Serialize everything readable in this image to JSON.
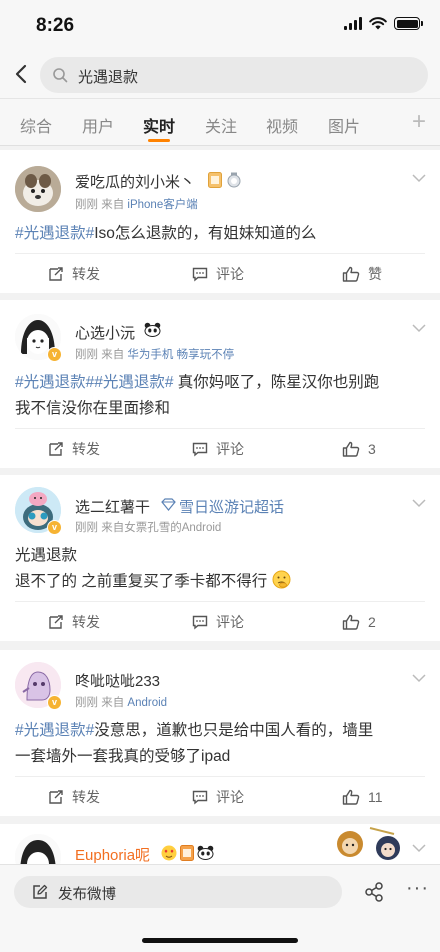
{
  "status_bar": {
    "time": "8:26"
  },
  "search": {
    "query": "光遇退款"
  },
  "tabs": [
    "综合",
    "用户",
    "实时",
    "关注",
    "视频",
    "图片"
  ],
  "actions": {
    "repost": "转发",
    "comment": "评论",
    "like": "赞"
  },
  "posts": [
    {
      "username": "爱吃瓜的刘小米丶",
      "meta_prefix": "刚刚  来自",
      "source": "iPhone客户端",
      "text": "#光遇退款#Iso怎么退款的，有姐妹知道的么",
      "like_count": "赞"
    },
    {
      "username": "心选小沅",
      "meta_prefix": "刚刚  来自",
      "source": "华为手机 畅享玩不停",
      "text_line1": "#光遇退款##光遇退款# 真你妈呕了，陈星汉你也别跑",
      "text_line2": "我不信没你在里面掺和",
      "like_count": "3"
    },
    {
      "username": "选二红薯干",
      "supertopic": "雪日巡游记超话",
      "meta_prefix": "刚刚  来自女票孔雪的Android",
      "text_line1": "光遇退款",
      "text_line2": "退不了的 之前重复买了季卡都不得行",
      "like_count": "2"
    },
    {
      "username": "咚呲哒呲233",
      "meta_prefix": "刚刚  来自",
      "source": "Android",
      "text_line1": "#光遇退款#没意思，道歉也只是给中国人看的，墙里",
      "text_line2": "一套墙外一套我真的受够了ipad",
      "like_count": "11"
    },
    {
      "username": "Euphoria呢"
    }
  ],
  "bottom_bar": {
    "compose": "发布微博"
  },
  "colors": {
    "accent": "#ff8200",
    "link": "#5b82b5",
    "orange_name": "#f26f21"
  }
}
